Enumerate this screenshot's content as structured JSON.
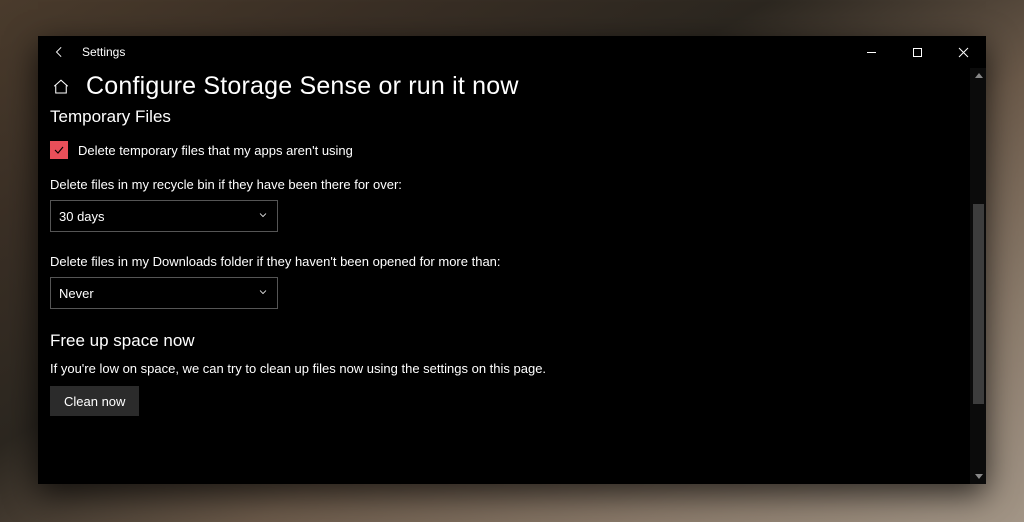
{
  "window": {
    "appTitle": "Settings"
  },
  "page": {
    "title": "Configure Storage Sense or run it now",
    "tempFiles": {
      "heading": "Temporary Files",
      "checkboxLabel": "Delete temporary files that my apps aren't using",
      "recycleLabel": "Delete files in my recycle bin if they have been there for over:",
      "recycleValue": "30 days",
      "downloadsLabel": "Delete files in my Downloads folder if they haven't been opened for more than:",
      "downloadsValue": "Never"
    },
    "freeUp": {
      "heading": "Free up space now",
      "description": "If you're low on space, we can try to clean up files now using the settings on this page.",
      "buttonLabel": "Clean now"
    }
  }
}
